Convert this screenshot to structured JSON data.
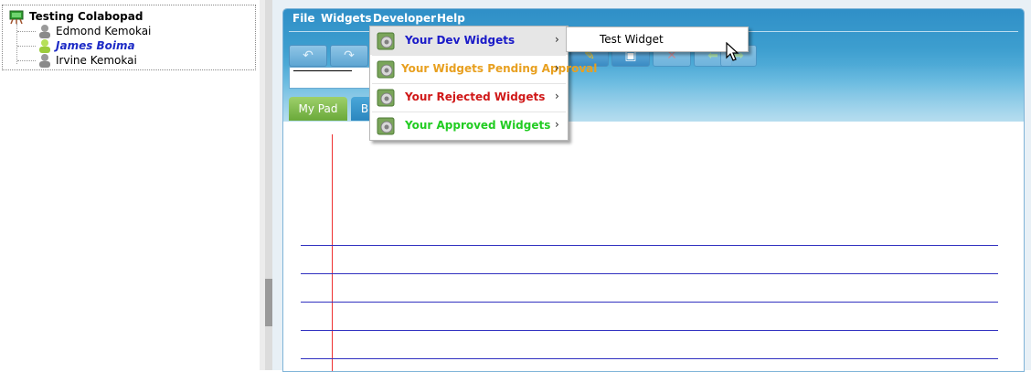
{
  "tree": {
    "root_label": "Testing Colabopad",
    "users": [
      {
        "label": "Edmond Kemokai",
        "selected": false
      },
      {
        "label": "James Boima",
        "selected": true
      },
      {
        "label": "Irvine Kemokai",
        "selected": false
      }
    ]
  },
  "menubar": {
    "file": "File",
    "widgets": "Widgets",
    "developer": "Developer",
    "help": "Help"
  },
  "tabs": {
    "mypad": "My Pad",
    "second": "B"
  },
  "developer_menu": {
    "items": [
      {
        "label": "Your Dev Widgets",
        "color": "#1a1ac8",
        "has_submenu": true
      },
      {
        "label": "Your Widgets Pending Approval",
        "color": "#e8a020",
        "has_submenu": true
      },
      {
        "label": "Your Rejected Widgets",
        "color": "#d01818",
        "has_submenu": true
      },
      {
        "label": "Your Approved Widgets",
        "color": "#22cc22",
        "has_submenu": true
      }
    ],
    "submenu_arrow": "›"
  },
  "dev_widgets_submenu": {
    "items": [
      "Test Widget"
    ]
  },
  "colors": {
    "banner": "#3d9ecf",
    "tab_active": "#7ab648",
    "margin_line": "#ee3030",
    "ruled_line": "#3030c0"
  }
}
